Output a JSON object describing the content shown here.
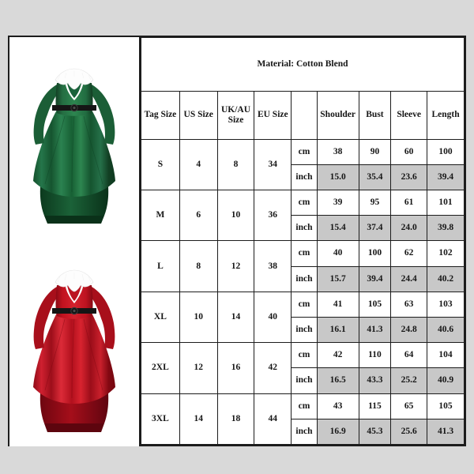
{
  "page": {
    "background_color": "#d9d9d9",
    "card_background": "#ffffff",
    "border_color": "#1c1c1c",
    "shaded_cell_color": "#c8c8c8"
  },
  "products": [
    {
      "name": "green-christmas-dress",
      "color_label": "green",
      "body_color": "#1f6b3e",
      "shade_color": "#14502c",
      "highlight_color": "#2d8650",
      "fur_color": "#fdfdfd",
      "belt_color": "#151515"
    },
    {
      "name": "red-christmas-dress",
      "color_label": "red",
      "body_color": "#c4121f",
      "shade_color": "#8f0a16",
      "highlight_color": "#dc2b38",
      "fur_color": "#fdfdfd",
      "belt_color": "#151515"
    }
  ],
  "table": {
    "material_note": "Material: Cotton Blend",
    "headers": {
      "tag_size": "Tag Size",
      "us_size": "US Size",
      "uk_au_size_line1": "UK/AU",
      "uk_au_size_line2": "Size",
      "eu_size": "EU Size",
      "unit": "",
      "shoulder": "Shoulder",
      "bust": "Bust",
      "sleeve": "Sleeve",
      "length": "Length"
    },
    "units": {
      "cm": "cm",
      "inch": "inch"
    },
    "rows": [
      {
        "tag_size": "S",
        "us_size": "4",
        "uk_au_size": "8",
        "eu_size": "34",
        "cm": {
          "shoulder": "38",
          "bust": "90",
          "sleeve": "60",
          "length": "100"
        },
        "inch": {
          "shoulder": "15.0",
          "bust": "35.4",
          "sleeve": "23.6",
          "length": "39.4"
        }
      },
      {
        "tag_size": "M",
        "us_size": "6",
        "uk_au_size": "10",
        "eu_size": "36",
        "cm": {
          "shoulder": "39",
          "bust": "95",
          "sleeve": "61",
          "length": "101"
        },
        "inch": {
          "shoulder": "15.4",
          "bust": "37.4",
          "sleeve": "24.0",
          "length": "39.8"
        }
      },
      {
        "tag_size": "L",
        "us_size": "8",
        "uk_au_size": "12",
        "eu_size": "38",
        "cm": {
          "shoulder": "40",
          "bust": "100",
          "sleeve": "62",
          "length": "102"
        },
        "inch": {
          "shoulder": "15.7",
          "bust": "39.4",
          "sleeve": "24.4",
          "length": "40.2"
        }
      },
      {
        "tag_size": "XL",
        "us_size": "10",
        "uk_au_size": "14",
        "eu_size": "40",
        "cm": {
          "shoulder": "41",
          "bust": "105",
          "sleeve": "63",
          "length": "103"
        },
        "inch": {
          "shoulder": "16.1",
          "bust": "41.3",
          "sleeve": "24.8",
          "length": "40.6"
        }
      },
      {
        "tag_size": "2XL",
        "us_size": "12",
        "uk_au_size": "16",
        "eu_size": "42",
        "cm": {
          "shoulder": "42",
          "bust": "110",
          "sleeve": "64",
          "length": "104"
        },
        "inch": {
          "shoulder": "16.5",
          "bust": "43.3",
          "sleeve": "25.2",
          "length": "40.9"
        }
      },
      {
        "tag_size": "3XL",
        "us_size": "14",
        "uk_au_size": "18",
        "eu_size": "44",
        "cm": {
          "shoulder": "43",
          "bust": "115",
          "sleeve": "65",
          "length": "105"
        },
        "inch": {
          "shoulder": "16.9",
          "bust": "45.3",
          "sleeve": "25.6",
          "length": "41.3"
        }
      }
    ]
  }
}
